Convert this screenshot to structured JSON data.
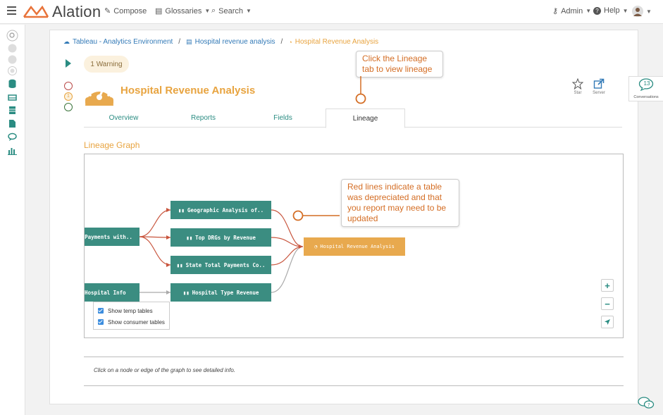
{
  "app": {
    "logo_text": "Alation",
    "nav": [
      {
        "label": "Compose",
        "icon": "pencil-icon"
      },
      {
        "label": "Glossaries",
        "icon": "book-icon"
      },
      {
        "label": "Search",
        "icon": "search-icon"
      }
    ],
    "admin_label": "Admin",
    "help_label": "Help"
  },
  "breadcrumb": {
    "item1": "Tableau - Analytics Environment",
    "item2": "Hospital revenue analysis",
    "current": "Hospital Revenue Analysis"
  },
  "warning_label": "1 Warning",
  "status_badge_count": "1",
  "page_title": "Hospital Revenue Analysis",
  "actions": {
    "star_label": "Star",
    "server_label": "Server"
  },
  "tabs": [
    {
      "label": "Overview"
    },
    {
      "label": "Reports"
    },
    {
      "label": "Fields"
    },
    {
      "label": "Lineage",
      "active": true
    }
  ],
  "lineage": {
    "section_title": "Lineage Graph",
    "nodes": {
      "payments": "Payments with..",
      "hospital_info": "Hospital Info",
      "geo": "Geographic Analysis of..",
      "drgs": "Top DRGs by Revenue",
      "state": "State Total Payments Co..",
      "type_rev": "Hospital Type Revenue",
      "report": "Hospital Revenue Analysis"
    },
    "checkboxes": {
      "temp": "Show temp tables",
      "consumer": "Show consumer tables"
    },
    "info_text": "Click on a node or edge of the graph to see detailed info.",
    "colors": {
      "table_node": "#3b8d81",
      "report_node": "#e8a94e",
      "deprecated_edge": "#c8553d",
      "normal_edge": "#aaaaaa"
    }
  },
  "callouts": {
    "lineage_tab": "Click the Lineage tab to view lineage",
    "red_lines": "Red lines indicate a table was depreciated and that you report may need to be updated"
  },
  "conversations": {
    "count": "13",
    "label": "Conversations"
  }
}
